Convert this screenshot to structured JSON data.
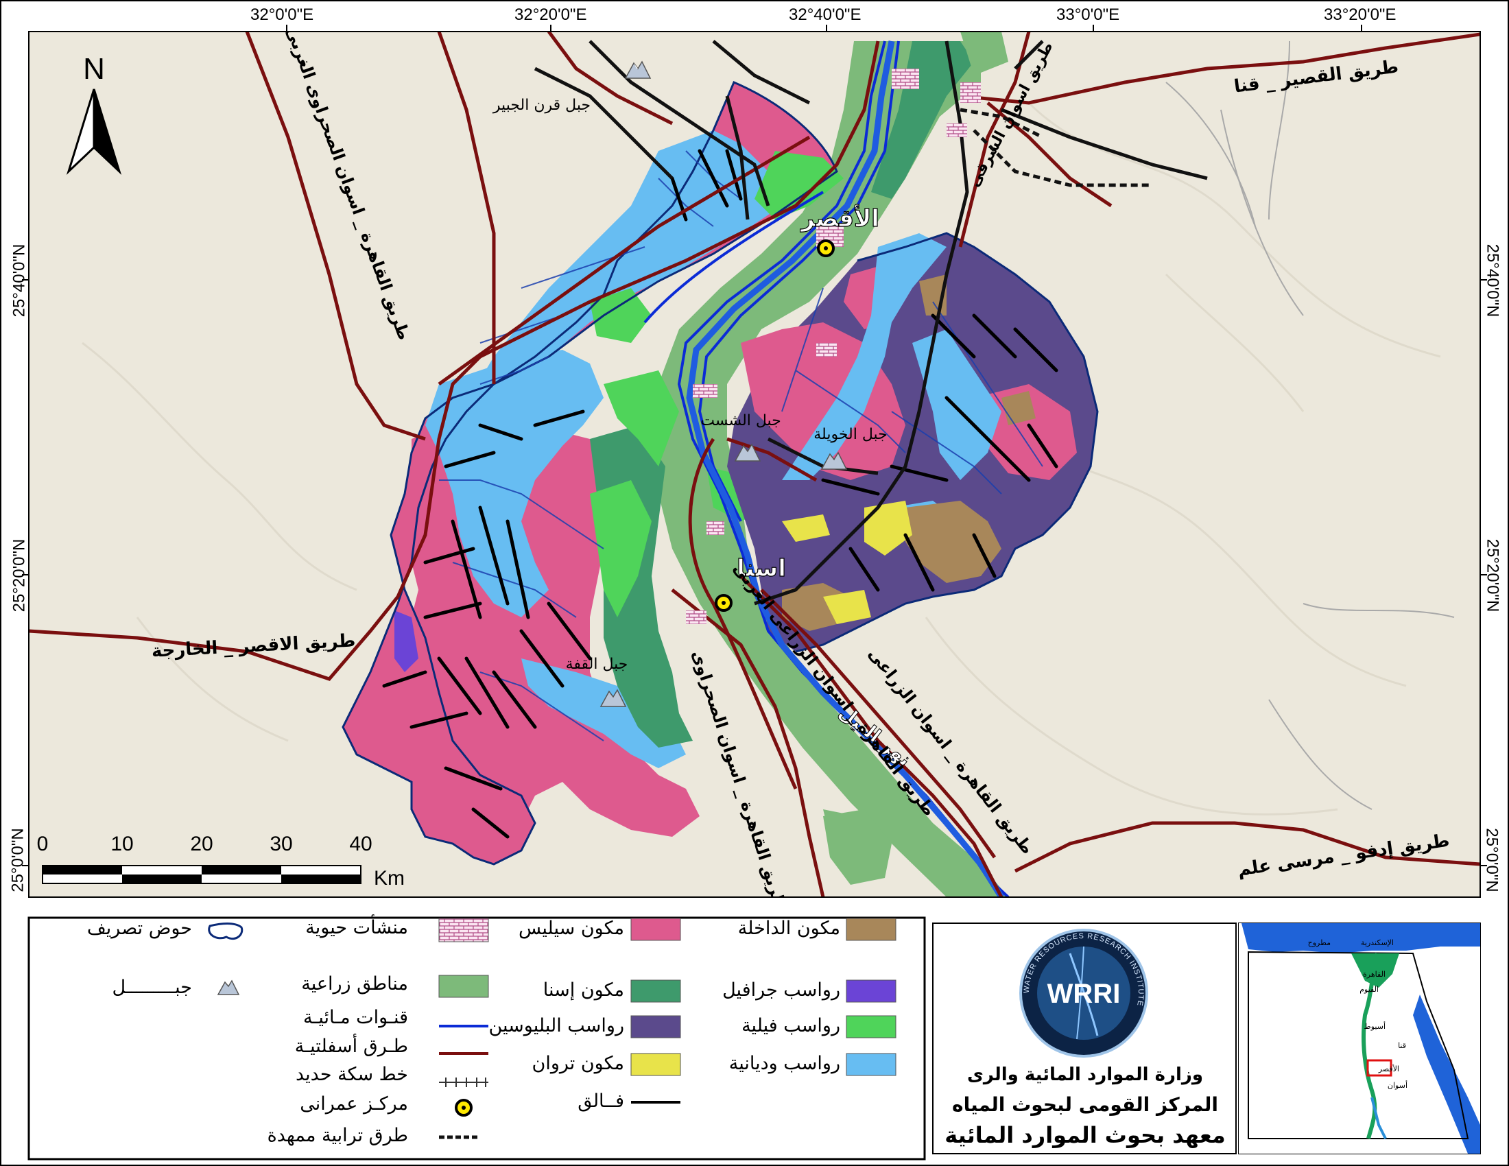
{
  "colors": {
    "sils": "#de5a8e",
    "esna": "#3e9a6c",
    "pliocene": "#5b4a8c",
    "tarawan": "#e8e34a",
    "dakhla": "#a8875a",
    "gravel": "#6b44d6",
    "vile": "#4fd45a",
    "wadi": "#67bdf2",
    "agri": "#7dba7a",
    "canal": "#0b2bd6",
    "road": "#7a0f0f",
    "fault": "#000000",
    "basin": "#0b2a78",
    "background": "#ece8dc"
  },
  "coords": {
    "top": [
      "32°0'0\"E",
      "32°20'0\"E",
      "32°40'0\"E",
      "33°0'0\"E",
      "33°20'0\"E"
    ],
    "left": [
      "25°40'0\"N",
      "25°20'0\"N",
      "25°0'0\"N"
    ],
    "right": [
      "25°40'0\"N",
      "25°20'0\"N",
      "25°0'0\"N"
    ]
  },
  "map": {
    "north": "N",
    "scalebar": {
      "ticks": [
        "0",
        "10",
        "20",
        "30",
        "40"
      ],
      "unit": "Km"
    },
    "labels": {
      "luxor": "الأقصر",
      "esna": "اسنا",
      "edfu_road": "طريق إدفو _ مرسى علم",
      "qusair_road": "طريق القصير _ قنا",
      "luxor_kharga": "طريق الاقصر _ الخارجة",
      "desert_west_road": "طريق القاهرة _ اسوان الصحراوى الغربى",
      "desert_east_road": "طريق القاهرة _ اسوان الصحراوى",
      "agri_east_road": "طريق القاهرة _ اسوان الزراعى",
      "agri_west_road": "طريق القاهرة _ اسوان الزراعى الغربى",
      "sharqi_road": "طريق اسوان الشرقى",
      "qurn": "جبل قرن الجبير",
      "shasht": "جبل الشست",
      "khaweyla": "جبل الخويلة",
      "qaqa": "جبل القفة",
      "nile": "نهر النيل"
    }
  },
  "legend": {
    "col1": [
      {
        "label": "حوض تصريف",
        "icon": "basin-icon"
      },
      {
        "label": "جبـــــــــل",
        "icon": "mountain-icon"
      }
    ],
    "col2": [
      {
        "label": "منشأت حيوية",
        "icon": "facility-icon"
      },
      {
        "label": "مناطق زراعية",
        "icon": "agri-icon"
      },
      {
        "label": "قنـوات مـائيـة",
        "icon": "canal-icon"
      },
      {
        "label": "طـرق أسفلتيـة",
        "icon": "road-icon"
      },
      {
        "label": "خط سكة حديد",
        "icon": "railway-icon"
      },
      {
        "label": "مركـز عمرانى",
        "icon": "urban-center-icon"
      },
      {
        "label": "طرق ترابية ممهدة",
        "icon": "dirt-road-icon"
      }
    ],
    "col3": [
      {
        "label": "مكون سيليس",
        "color": "#de5a8e"
      },
      {
        "label": "مكون إسنا",
        "color": "#3e9a6c"
      },
      {
        "label": "رواسب البليوسين",
        "color": "#5b4a8c"
      },
      {
        "label": "مكون تروان",
        "color": "#e8e34a"
      },
      {
        "label": "فــالق",
        "color": "line"
      }
    ],
    "col4": [
      {
        "label": "مكون الداخلة",
        "color": "#a8875a"
      },
      {
        "label": "رواسب جرافيل",
        "color": "#6b44d6"
      },
      {
        "label": "رواسب فيلية",
        "color": "#4fd45a"
      },
      {
        "label": "رواسب وديانية",
        "color": "#67bdf2"
      }
    ]
  },
  "institute": {
    "logo_text": "WRRI",
    "ring_text": "WATER RESOURCES RESEARCH INSTITUTE",
    "line1": "وزارة الموارد المائية والرى",
    "line2": "المركز القومى لبحوث المياه",
    "line3": "معهد بحوث الموارد المائية"
  },
  "inset": {
    "labels": [
      "مطروح",
      "الإسكندرية",
      "القاهرة",
      "الفيوم",
      "أسيوط",
      "قنا",
      "الأقصر",
      "أسوان"
    ]
  }
}
